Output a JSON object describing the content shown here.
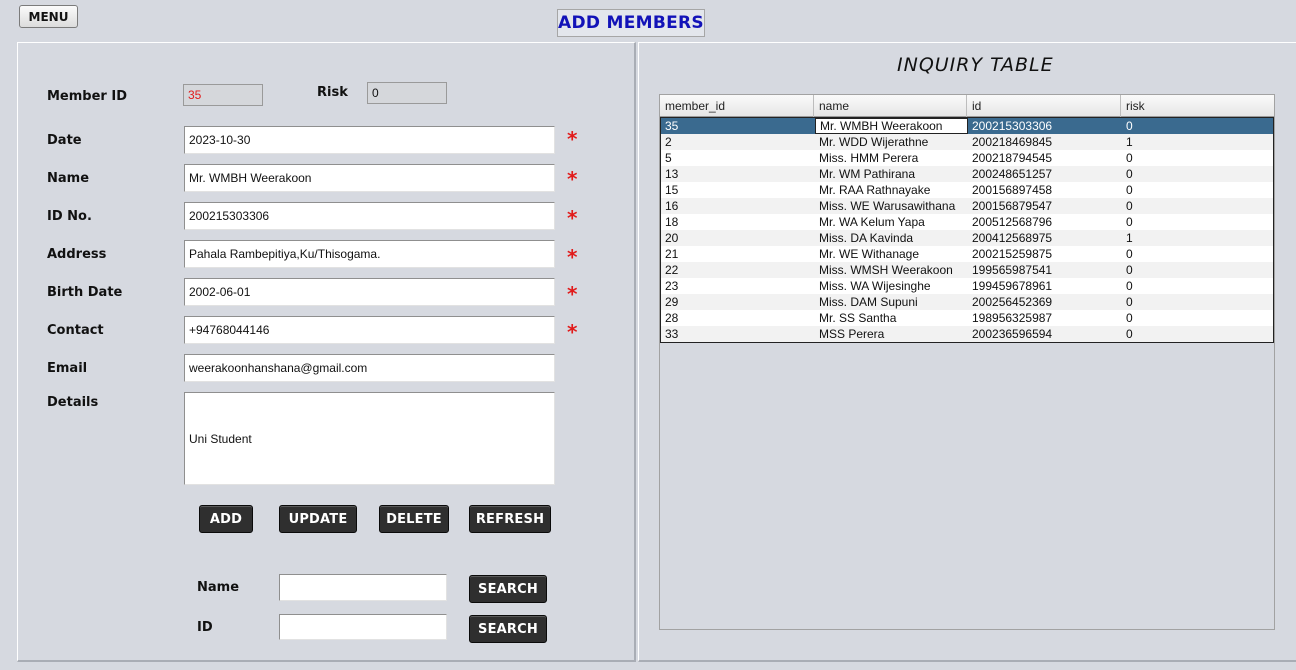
{
  "menu_label": "MENU",
  "page_title": "ADD MEMBERS",
  "form": {
    "member_id_label": "Member ID",
    "member_id_value": "35",
    "risk_label": "Risk",
    "risk_value": "0",
    "date_label": "Date",
    "date_value": "2023-10-30",
    "name_label": "Name",
    "name_value": "Mr. WMBH Weerakoon",
    "idno_label": "ID No.",
    "idno_value": "200215303306",
    "address_label": "Address",
    "address_value": "Pahala Rambepitiya,Ku/Thisogama.",
    "birth_label": "Birth Date",
    "birth_value": "2002-06-01",
    "contact_label": "Contact",
    "contact_value": "+94768044146",
    "email_label": "Email",
    "email_value": "weerakoonhanshana@gmail.com",
    "details_label": "Details",
    "details_value": "Uni Student",
    "required_mark": "*"
  },
  "actions": {
    "add": "ADD",
    "update": "UPDATE",
    "delete": "DELETE",
    "refresh": "REFRESH"
  },
  "search": {
    "name_label": "Name",
    "id_label": "ID",
    "name_value": "",
    "id_value": "",
    "button_label": "SEARCH"
  },
  "inquiry": {
    "title": "INQUIRY TABLE",
    "columns": [
      "member_id",
      "name",
      "id",
      "risk"
    ],
    "rows": [
      [
        "35",
        "Mr. WMBH Weerakoon",
        "200215303306",
        "0"
      ],
      [
        "2",
        "Mr. WDD Wijerathne",
        "200218469845",
        "1"
      ],
      [
        "5",
        "Miss. HMM Perera",
        "200218794545",
        "0"
      ],
      [
        "13",
        "Mr. WM Pathirana",
        "200248651257",
        "0"
      ],
      [
        "15",
        "Mr. RAA Rathnayake",
        "200156897458",
        "0"
      ],
      [
        "16",
        "Miss. WE Warusawithana",
        "200156879547",
        "0"
      ],
      [
        "18",
        "Mr. WA Kelum Yapa",
        "200512568796",
        "0"
      ],
      [
        "20",
        "Miss. DA Kavinda",
        "200412568975",
        "1"
      ],
      [
        "21",
        "Mr. WE Withanage",
        "200215259875",
        "0"
      ],
      [
        "22",
        "Miss. WMSH Weerakoon",
        "199565987541",
        "0"
      ],
      [
        "23",
        "Miss. WA Wijesinghe",
        "199459678961",
        "0"
      ],
      [
        "29",
        "Miss. DAM Supuni",
        "200256452369",
        "0"
      ],
      [
        "28",
        "Mr. SS Santha",
        "198956325987",
        "0"
      ],
      [
        "33",
        "MSS Perera",
        "200236596594",
        "0"
      ]
    ],
    "selected_row": 0
  }
}
